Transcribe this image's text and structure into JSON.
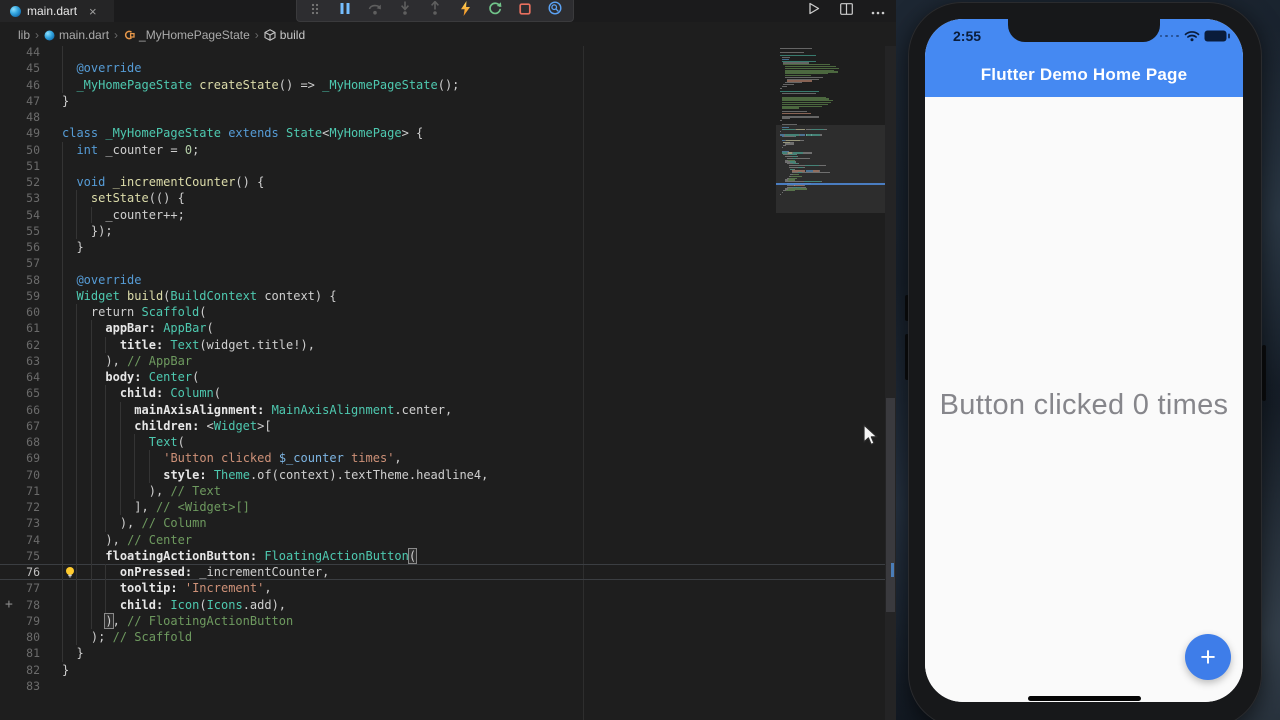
{
  "editor": {
    "tab": {
      "title": "main.dart",
      "close_glyph": "×"
    },
    "breadcrumb": {
      "items": [
        "lib",
        "main.dart",
        "_MyHomePageState",
        "build"
      ],
      "separator": "›"
    },
    "debug_toolbar": {
      "buttons": [
        "drag-grip",
        "pause",
        "step-over",
        "step-into",
        "step-out",
        "hot-reload",
        "restart",
        "stop",
        "widget-inspector"
      ]
    },
    "editor_actions": [
      "run",
      "split-editor",
      "more-actions"
    ],
    "gutter_plus_glyph": "+",
    "code": {
      "lines": [
        {
          "n": 44,
          "indent": 0,
          "guides": [
            0
          ],
          "tokens": []
        },
        {
          "n": 45,
          "indent": 2,
          "tokens": [
            [
              "kw",
              "@override"
            ]
          ]
        },
        {
          "n": 46,
          "indent": 2,
          "tokens": [
            [
              "type",
              "_MyHomePageState"
            ],
            [
              "txt",
              " "
            ],
            [
              "fn",
              "createState"
            ],
            [
              "txt",
              "() => "
            ],
            [
              "type",
              "_MyHomePageState"
            ],
            [
              "txt",
              "();"
            ]
          ]
        },
        {
          "n": 47,
          "indent": 0,
          "tokens": [
            [
              "txt",
              "}"
            ]
          ]
        },
        {
          "n": 48,
          "indent": 0,
          "guides": [],
          "tokens": []
        },
        {
          "n": 49,
          "indent": 0,
          "tokens": [
            [
              "kw",
              "class"
            ],
            [
              "txt",
              " "
            ],
            [
              "type",
              "_MyHomePageState"
            ],
            [
              "txt",
              " "
            ],
            [
              "kw",
              "extends"
            ],
            [
              "txt",
              " "
            ],
            [
              "type",
              "State"
            ],
            [
              "txt",
              "<"
            ],
            [
              "type",
              "MyHomePage"
            ],
            [
              "txt",
              "> {"
            ]
          ]
        },
        {
          "n": 50,
          "indent": 2,
          "tokens": [
            [
              "kw",
              "int"
            ],
            [
              "txt",
              " _counter = "
            ],
            [
              "num",
              "0"
            ],
            [
              "txt",
              ";"
            ]
          ]
        },
        {
          "n": 51,
          "indent": 0,
          "guides": [
            0
          ],
          "tokens": []
        },
        {
          "n": 52,
          "indent": 2,
          "tokens": [
            [
              "kw",
              "void"
            ],
            [
              "txt",
              " "
            ],
            [
              "fn",
              "_incrementCounter"
            ],
            [
              "txt",
              "() {"
            ]
          ]
        },
        {
          "n": 53,
          "indent": 4,
          "tokens": [
            [
              "fn",
              "setState"
            ],
            [
              "txt",
              "(() {"
            ]
          ]
        },
        {
          "n": 54,
          "indent": 6,
          "tokens": [
            [
              "txt",
              "_counter++;"
            ]
          ]
        },
        {
          "n": 55,
          "indent": 4,
          "tokens": [
            [
              "txt",
              "});"
            ]
          ]
        },
        {
          "n": 56,
          "indent": 2,
          "tokens": [
            [
              "txt",
              "}"
            ]
          ]
        },
        {
          "n": 57,
          "indent": 0,
          "guides": [
            0
          ],
          "tokens": []
        },
        {
          "n": 58,
          "indent": 2,
          "tokens": [
            [
              "kw",
              "@override"
            ]
          ]
        },
        {
          "n": 59,
          "indent": 2,
          "tokens": [
            [
              "type",
              "Widget"
            ],
            [
              "txt",
              " "
            ],
            [
              "fn",
              "build"
            ],
            [
              "txt",
              "("
            ],
            [
              "type",
              "BuildContext"
            ],
            [
              "txt",
              " context) {"
            ]
          ]
        },
        {
          "n": 60,
          "indent": 4,
          "tokens": [
            [
              "txt",
              "return "
            ],
            [
              "type",
              "Scaffold"
            ],
            [
              "txt",
              "("
            ]
          ]
        },
        {
          "n": 61,
          "indent": 6,
          "tokens": [
            [
              "prop",
              "appBar:"
            ],
            [
              "txt",
              " "
            ],
            [
              "type",
              "AppBar"
            ],
            [
              "txt",
              "("
            ]
          ]
        },
        {
          "n": 62,
          "indent": 8,
          "tokens": [
            [
              "prop",
              "title:"
            ],
            [
              "txt",
              " "
            ],
            [
              "type",
              "Text"
            ],
            [
              "txt",
              "(widget.title!),"
            ]
          ]
        },
        {
          "n": 63,
          "indent": 6,
          "tokens": [
            [
              "txt",
              "), "
            ],
            [
              "cmt",
              "// AppBar"
            ]
          ]
        },
        {
          "n": 64,
          "indent": 6,
          "tokens": [
            [
              "prop",
              "body:"
            ],
            [
              "txt",
              " "
            ],
            [
              "type",
              "Center"
            ],
            [
              "txt",
              "("
            ]
          ]
        },
        {
          "n": 65,
          "indent": 8,
          "tokens": [
            [
              "prop",
              "child:"
            ],
            [
              "txt",
              " "
            ],
            [
              "type",
              "Column"
            ],
            [
              "txt",
              "("
            ]
          ]
        },
        {
          "n": 66,
          "indent": 10,
          "tokens": [
            [
              "prop",
              "mainAxisAlignment:"
            ],
            [
              "txt",
              " "
            ],
            [
              "type",
              "MainAxisAlignment"
            ],
            [
              "txt",
              ".center,"
            ]
          ]
        },
        {
          "n": 67,
          "indent": 10,
          "tokens": [
            [
              "prop",
              "children:"
            ],
            [
              "txt",
              " <"
            ],
            [
              "type",
              "Widget"
            ],
            [
              "txt",
              ">["
            ]
          ]
        },
        {
          "n": 68,
          "indent": 12,
          "tokens": [
            [
              "type",
              "Text"
            ],
            [
              "txt",
              "("
            ]
          ]
        },
        {
          "n": 69,
          "indent": 14,
          "tokens": [
            [
              "str",
              "'Button clicked "
            ],
            [
              "interp",
              "$_counter"
            ],
            [
              "str",
              " times'"
            ],
            [
              "txt",
              ","
            ]
          ]
        },
        {
          "n": 70,
          "indent": 14,
          "tokens": [
            [
              "prop",
              "style:"
            ],
            [
              "txt",
              " "
            ],
            [
              "type",
              "Theme"
            ],
            [
              "txt",
              ".of(context).textTheme.headline4,"
            ]
          ]
        },
        {
          "n": 71,
          "indent": 12,
          "tokens": [
            [
              "txt",
              "), "
            ],
            [
              "cmt",
              "// Text"
            ]
          ]
        },
        {
          "n": 72,
          "indent": 10,
          "tokens": [
            [
              "txt",
              "], "
            ],
            [
              "cmt",
              "// <Widget>[]"
            ]
          ]
        },
        {
          "n": 73,
          "indent": 8,
          "tokens": [
            [
              "txt",
              "), "
            ],
            [
              "cmt",
              "// Column"
            ]
          ]
        },
        {
          "n": 74,
          "indent": 6,
          "tokens": [
            [
              "txt",
              "), "
            ],
            [
              "cmt",
              "// Center"
            ]
          ]
        },
        {
          "n": 75,
          "indent": 6,
          "tokens": [
            [
              "prop",
              "floatingActionButton:"
            ],
            [
              "txt",
              " "
            ],
            [
              "type",
              "FloatingActionButton"
            ],
            [
              "brk",
              "("
            ]
          ]
        },
        {
          "n": 76,
          "indent": 8,
          "current": true,
          "lightbulb": true,
          "tokens": [
            [
              "prop",
              "onPressed:"
            ],
            [
              "txt",
              " _incrementCounter,"
            ]
          ]
        },
        {
          "n": 77,
          "indent": 8,
          "tokens": [
            [
              "prop",
              "tooltip:"
            ],
            [
              "txt",
              " "
            ],
            [
              "str",
              "'Increment'"
            ],
            [
              "txt",
              ","
            ]
          ]
        },
        {
          "n": 78,
          "indent": 8,
          "gutter_plus": true,
          "tokens": [
            [
              "prop",
              "child:"
            ],
            [
              "txt",
              " "
            ],
            [
              "type",
              "Icon"
            ],
            [
              "txt",
              "("
            ],
            [
              "type",
              "Icons"
            ],
            [
              "txt",
              ".add),"
            ]
          ]
        },
        {
          "n": 79,
          "indent": 6,
          "tokens": [
            [
              "brk",
              ")"
            ],
            [
              "txt",
              ", "
            ],
            [
              "cmt",
              "// FloatingActionButton"
            ]
          ]
        },
        {
          "n": 80,
          "indent": 4,
          "tokens": [
            [
              "txt",
              "); "
            ],
            [
              "cmt",
              "// Scaffold"
            ]
          ]
        },
        {
          "n": 81,
          "indent": 2,
          "tokens": [
            [
              "txt",
              "}"
            ]
          ]
        },
        {
          "n": 82,
          "indent": 0,
          "tokens": [
            [
              "txt",
              "}"
            ]
          ]
        },
        {
          "n": 83,
          "indent": 0,
          "guides": [],
          "tokens": []
        }
      ]
    }
  },
  "phone": {
    "status": {
      "time": "2:55",
      "icons": [
        "cellular-dots",
        "wifi-icon",
        "battery-icon"
      ]
    },
    "app_bar_title": "Flutter Demo Home Page",
    "body_text": "Button clicked 0 times",
    "fab_icon": "+",
    "colors": {
      "app_bar": "#4589F2",
      "fab": "#3E7DE9",
      "body": "#FAFAFA",
      "counter_text": "#86868B"
    }
  },
  "toolbar_colors": {
    "pause_blue": "#75BEFF",
    "hot_reload_yellow": "#F5B82E",
    "restart_green": "#71C48A",
    "stop_red": "#E8705E",
    "inspector_blue": "#5CA3F5"
  }
}
